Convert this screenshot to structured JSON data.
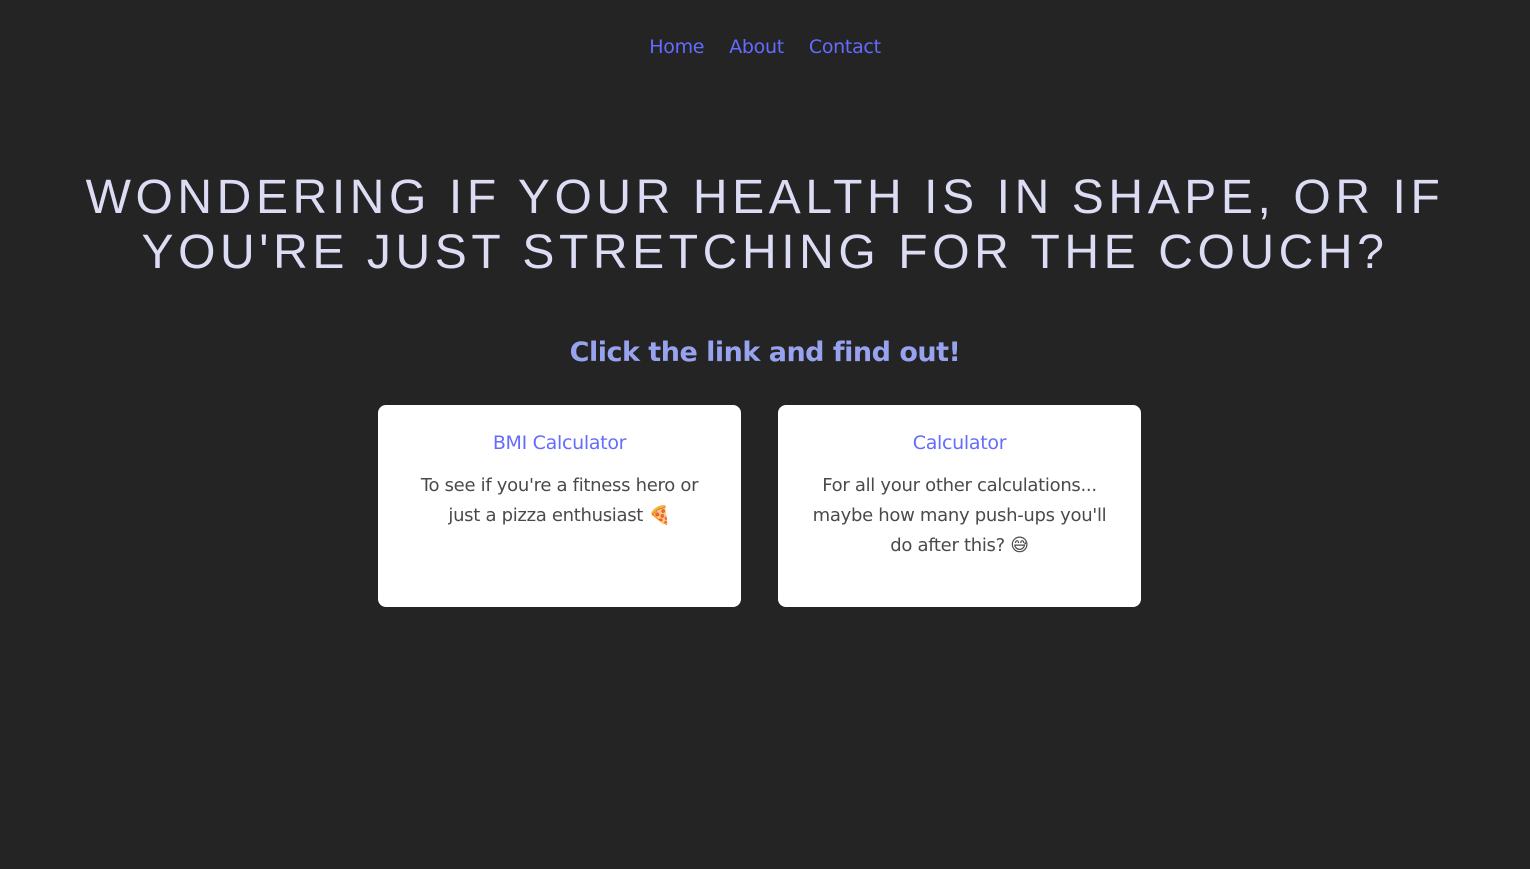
{
  "nav": {
    "items": [
      {
        "label": "Home"
      },
      {
        "label": "About"
      },
      {
        "label": "Contact"
      }
    ]
  },
  "hero": {
    "title": "WONDERING IF YOUR HEALTH IS IN SHAPE, OR IF YOU'RE JUST STRETCHING FOR THE COUCH?"
  },
  "subtitle": "Click the link and find out!",
  "cards": [
    {
      "title": "BMI Calculator",
      "description": "To see if you're a fitness hero or just a pizza enthusiast 🍕"
    },
    {
      "title": "Calculator",
      "description": "For all your other calculations... maybe how many push-ups you'll do after this? 😅"
    }
  ],
  "colors": {
    "background": "#242424",
    "link": "#646cff",
    "hero_text": "#dcdcf4",
    "subtitle": "#98a3f0",
    "card_bg": "#ffffff"
  }
}
